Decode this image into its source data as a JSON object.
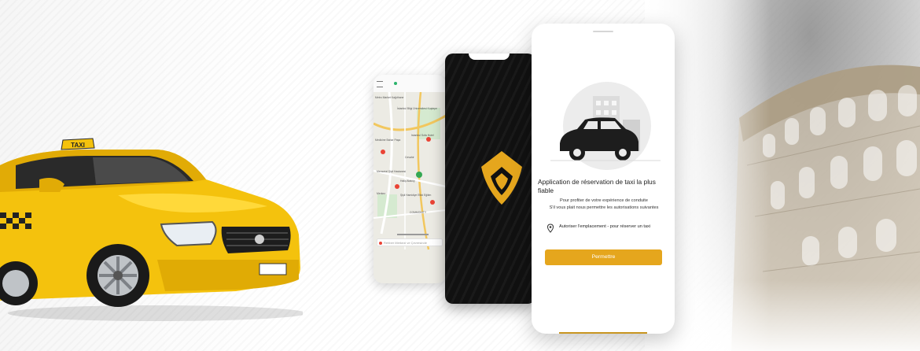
{
  "colors": {
    "brand_gold": "#e5a61d",
    "taxi_yellow": "#f4c20d",
    "dark_screen": "#111111"
  },
  "taxi": {
    "roof_sign": "TAXI"
  },
  "map_phone": {
    "labels": [
      "Metro Market Kağıthane",
      "İstanbul Bilgi Üniversitesi Kuştepe",
      "Medicine Bahar Paşa",
      "Istanbul Sofa Hotel",
      "Cevahir",
      "Memorial Şişli Hastanesi",
      "Haliç Ataköy",
      "Merkez",
      "Şişli Hamidiye Etfal Eğitim",
      "COMMONITY"
    ],
    "search_placeholder": "Rehber Merkezi ve Çevresinde"
  },
  "splash_phone": {
    "logo_icon": "brand-v-logo-icon"
  },
  "main_phone": {
    "title": "Application de réservation de taxi la plus fiable",
    "subtitle_line1": "Pour profiter de votre expérience de conduite",
    "subtitle_line2": "S'il vous plait nous permettre les autorisations suivantes",
    "permission": {
      "icon": "location-pin-icon",
      "text": "Autoriser l'emplacement - pour réserver un taxi"
    },
    "button_label": "Permettre"
  }
}
